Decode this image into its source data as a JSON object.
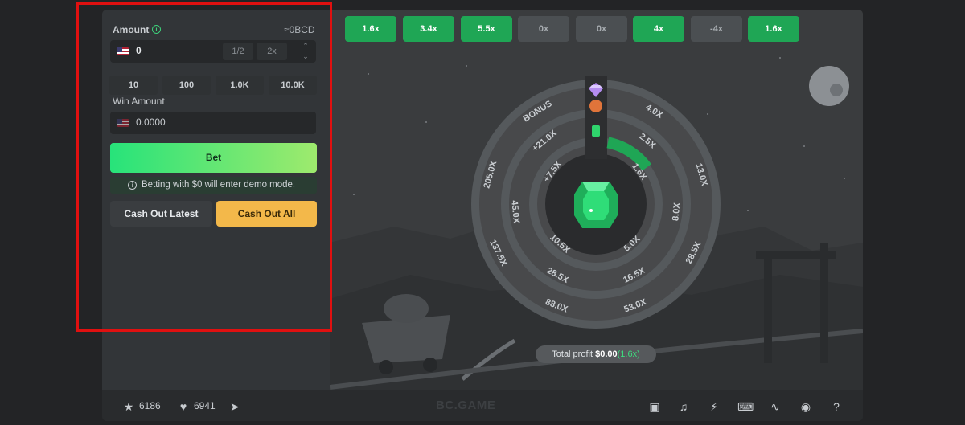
{
  "bet_panel": {
    "amount_label": "Amount",
    "currency_value": "≈0BCD",
    "amount_value": "0",
    "half_label": "1/2",
    "double_label": "2x",
    "quick_amounts": [
      "10",
      "100",
      "1.0K",
      "10.0K"
    ],
    "win_amount_label": "Win Amount",
    "win_amount_value": "0.0000",
    "bet_label": "Bet",
    "demo_notice": "Betting with $0 will enter demo mode.",
    "cash_out_latest_label": "Cash Out Latest",
    "cash_out_all_label": "Cash Out All"
  },
  "history": [
    "1.6x",
    "3.4x",
    "5.5x",
    "0x",
    "0x",
    "4x",
    "-4x",
    "1.6x"
  ],
  "history_colors": [
    "green",
    "green",
    "green",
    "dark",
    "dark",
    "green",
    "dark",
    "green"
  ],
  "wheel": {
    "outer_labels": [
      "4.0X",
      "13.0X",
      "28.5X",
      "53.0X",
      "88.0X",
      "137.5X",
      "205.0X",
      "BONUS"
    ],
    "middle_labels": [
      "2.5X",
      "8.0X",
      "16.5X",
      "28.5X",
      "45.0X",
      "+21.0X"
    ],
    "inner_labels": [
      "1.6X",
      "5.0X",
      "10.5X",
      "+7.5X"
    ],
    "progress_fraction": 0.1
  },
  "profit": {
    "label": "Total profit",
    "amount": "$0.00",
    "multiplier": "(1.6x)"
  },
  "footer": {
    "star_count": "6186",
    "heart_count": "6941",
    "brand": "BC.GAME"
  },
  "colors": {
    "accent_green": "#1fa655",
    "bet_gradient_start": "#27e37a",
    "bet_gradient_end": "#9eea6d",
    "cash_out_all": "#f3b84a",
    "panel_bg": "#323538"
  }
}
